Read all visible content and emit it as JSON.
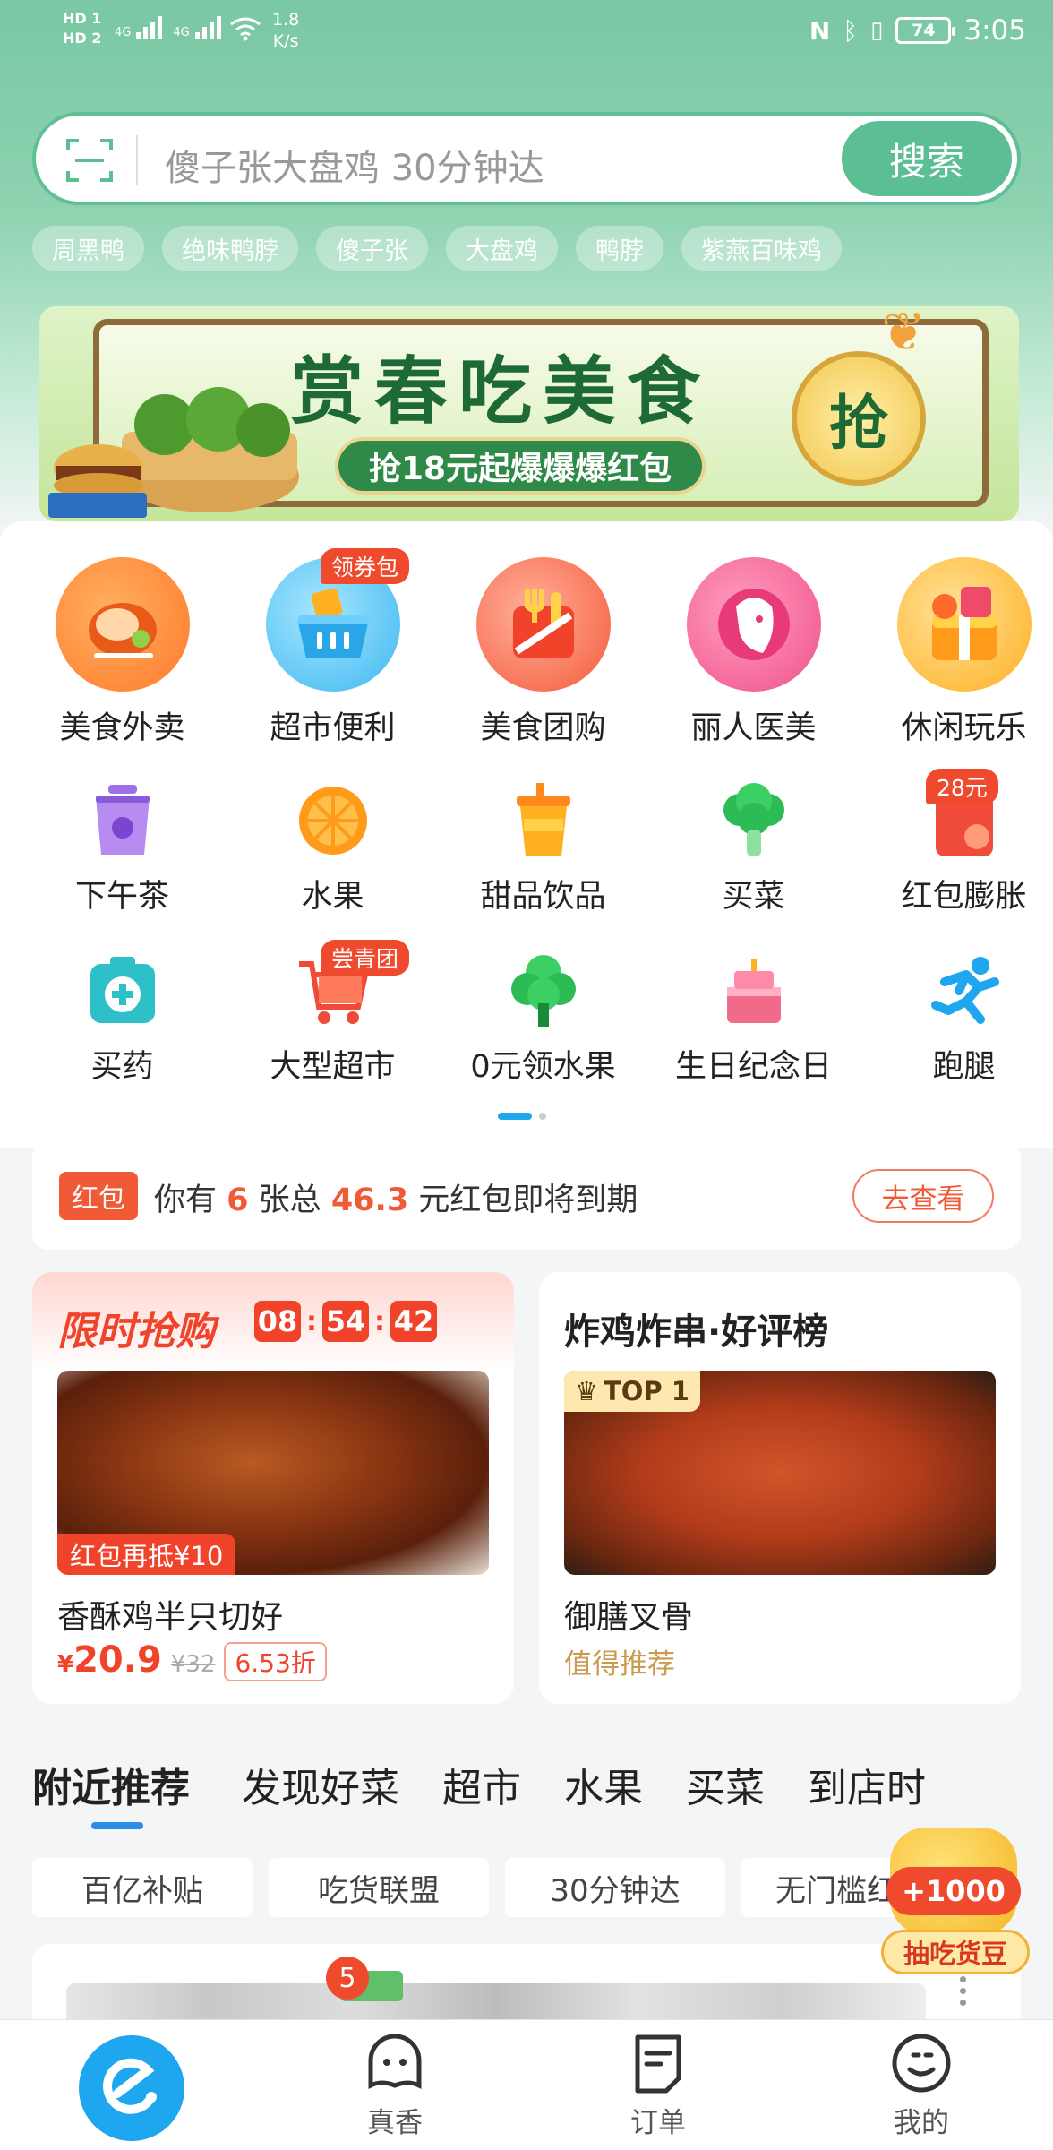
{
  "status_bar": {
    "network_top": "HD 1",
    "network_bottom": "HD 2",
    "sig1": "4G",
    "sig2": "4G",
    "speed_value": "1.8",
    "speed_unit": "K/s",
    "battery": "74",
    "time": "3:05"
  },
  "search": {
    "placeholder": "傻子张大盘鸡 30分钟达",
    "button": "搜索"
  },
  "hot_tags": [
    "周黑鸭",
    "绝味鸭脖",
    "傻子张",
    "大盘鸡",
    "鸭脖",
    "紫燕百味鸡"
  ],
  "banner": {
    "title": "赏春吃美食",
    "subtitle": "抢18元起爆爆爆红包",
    "badge": "抢"
  },
  "categories_main": [
    {
      "label": "美食外卖",
      "icon": "roast-chicken-icon",
      "color": "#ff7a2a"
    },
    {
      "label": "超市便利",
      "icon": "shopping-basket-icon",
      "color": "#3db8f0",
      "badge": "领券包"
    },
    {
      "label": "美食团购",
      "icon": "fork-bowl-icon",
      "color": "#f55a3a"
    },
    {
      "label": "丽人医美",
      "icon": "woman-face-icon",
      "color": "#f0508a"
    },
    {
      "label": "休闲玩乐",
      "icon": "gift-box-icon",
      "color": "#ffb020"
    }
  ],
  "categories_small": [
    {
      "label": "下午茶",
      "icon": "milk-tea-icon",
      "color": "#a070e8"
    },
    {
      "label": "水果",
      "icon": "orange-icon",
      "color": "#ff9a1a"
    },
    {
      "label": "甜品饮品",
      "icon": "drink-cup-icon",
      "color": "#ffa81a"
    },
    {
      "label": "买菜",
      "icon": "broccoli-icon",
      "color": "#2dbb55"
    },
    {
      "label": "红包膨胀",
      "icon": "red-envelope-icon",
      "color": "#f04a3a",
      "badge": "28元"
    },
    {
      "label": "买药",
      "icon": "medicine-box-icon",
      "color": "#2ec0c8"
    },
    {
      "label": "大型超市",
      "icon": "shopping-cart-icon",
      "color": "#f04a3a",
      "badge": "尝青团"
    },
    {
      "label": "0元领水果",
      "icon": "tree-icon",
      "color": "#2dbb55"
    },
    {
      "label": "生日纪念日",
      "icon": "cake-icon",
      "color": "#f06a8a"
    },
    {
      "label": "跑腿",
      "icon": "runner-icon",
      "color": "#1ea6ef"
    }
  ],
  "red_packet": {
    "tag": "红包",
    "prefix": "你有",
    "count": "6",
    "mid": "张总",
    "amount": "46.3",
    "suffix": "元红包即将到期",
    "button": "去查看"
  },
  "flash_sale": {
    "title": "限时抢购",
    "hh": "08",
    "mm": "54",
    "ss": "42",
    "tag": "红包再抵¥10",
    "name": "香酥鸡半只切好",
    "currency": "¥",
    "price": "20.9",
    "orig": "¥32",
    "discount": "6.53折"
  },
  "ranking": {
    "title": "炸鸡炸串·好评榜",
    "badge": "TOP 1",
    "name": "御膳叉骨",
    "rec": "值得推荐"
  },
  "tabs": [
    "附近推荐",
    "发现好菜",
    "超市",
    "水果",
    "买菜",
    "到店时"
  ],
  "chips": [
    "百亿补贴",
    "吃货联盟",
    "30分钟达",
    "无门槛红包"
  ],
  "float": {
    "num": "+1000",
    "label": "抽吃货豆"
  },
  "shop_badge": "5",
  "nav": [
    {
      "label": "真香",
      "icon": "ghost-icon"
    },
    {
      "label": "订单",
      "icon": "order-icon"
    },
    {
      "label": "我的",
      "icon": "smile-face-icon"
    }
  ]
}
